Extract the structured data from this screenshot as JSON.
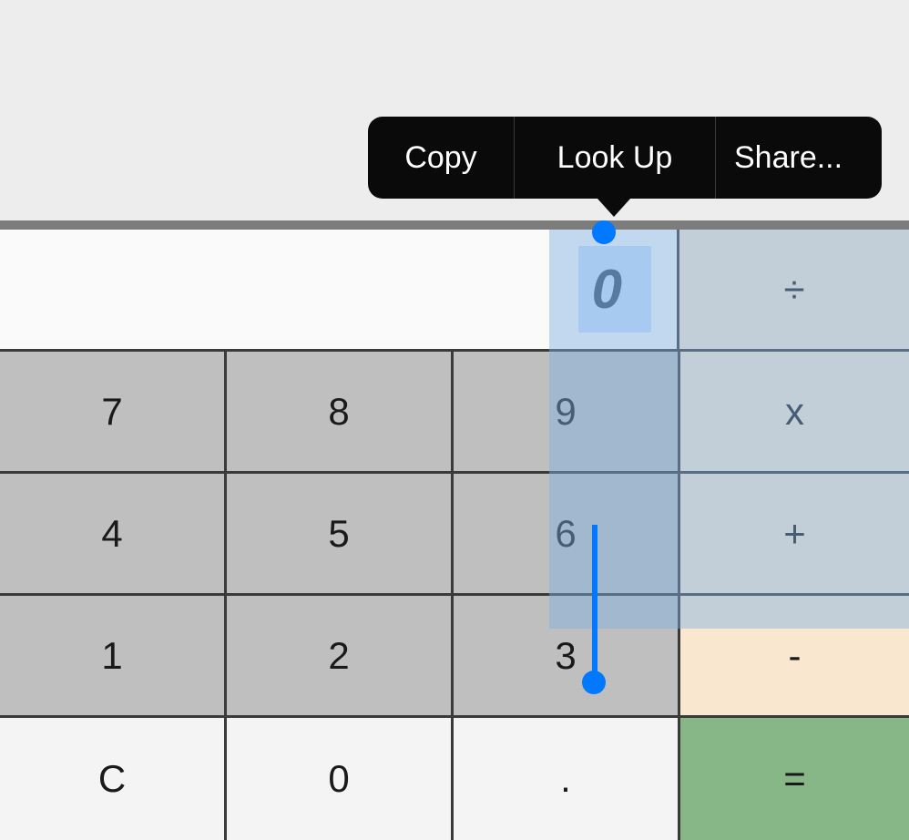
{
  "menu": {
    "copy": "Copy",
    "lookup": "Look Up",
    "share": "Share..."
  },
  "display": {
    "value": "0"
  },
  "ops": {
    "divide": "÷",
    "multiply": "x",
    "plus": "+",
    "minus": "-",
    "equals": "="
  },
  "keys": {
    "k7": "7",
    "k8": "8",
    "k9": "9",
    "k4": "4",
    "k5": "5",
    "k6": "6",
    "k1": "1",
    "k2": "2",
    "k3": "3",
    "clear": "C",
    "k0": "0",
    "dot": "."
  }
}
